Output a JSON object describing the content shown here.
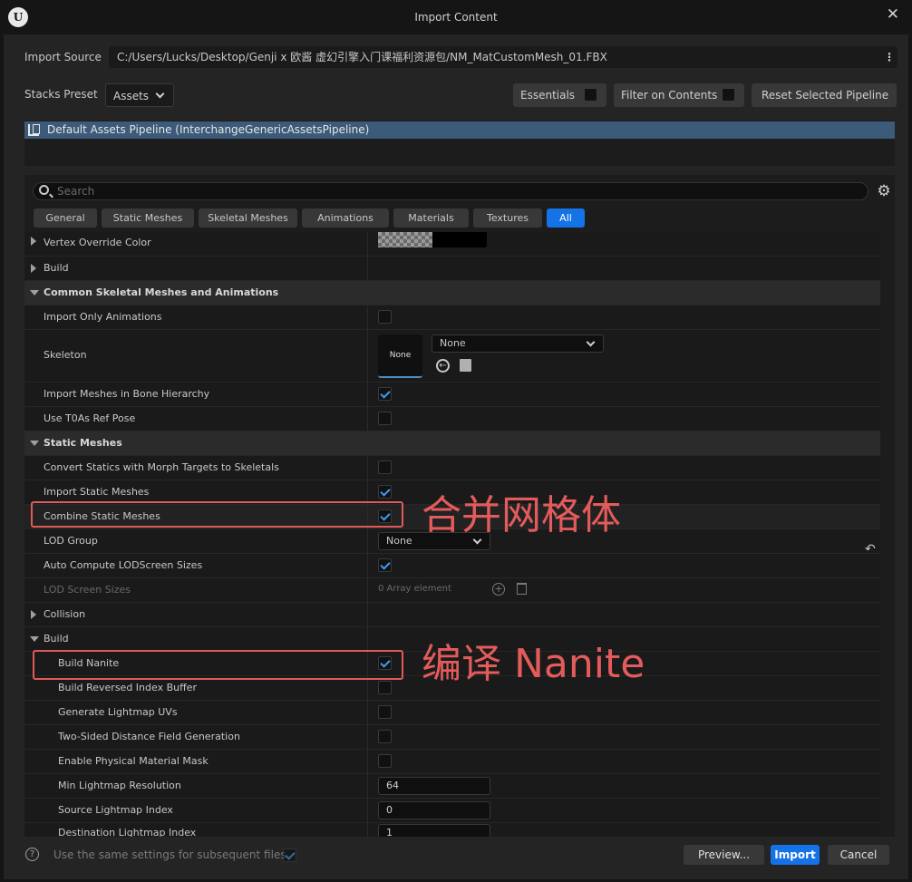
{
  "window": {
    "title": "Import Content"
  },
  "import_source": {
    "label": "Import Source",
    "path": "C:/Users/Lucks/Desktop/Genji x 欧酱 虚幻引擎入门课福利资源包/NM_MatCustomMesh_01.FBX"
  },
  "stacks_preset": {
    "label": "Stacks Preset",
    "value": "Assets",
    "essentials_label": "Essentials",
    "filter_on_contents_label": "Filter on Contents",
    "reset_label": "Reset Selected Pipeline"
  },
  "pipeline": {
    "label": "Default Assets Pipeline (InterchangeGenericAssetsPipeline)"
  },
  "search": {
    "placeholder": "Search"
  },
  "tabs": [
    {
      "label": "General"
    },
    {
      "label": "Static Meshes"
    },
    {
      "label": "Skeletal Meshes"
    },
    {
      "label": "Animations"
    },
    {
      "label": "Materials"
    },
    {
      "label": "Textures"
    },
    {
      "label": "All"
    }
  ],
  "rows": {
    "vertex_override_color": "Vertex Override Color",
    "build_top": "Build",
    "cat_common_skeletal": "Common Skeletal Meshes and Animations",
    "import_only_animations": "Import Only Animations",
    "skeleton": "Skeleton",
    "skeleton_thumb": "None",
    "skeleton_value": "None",
    "import_meshes_bone_hierarchy": "Import Meshes in Bone Hierarchy",
    "use_t0as_ref_pose": "Use T0As Ref Pose",
    "cat_static_meshes": "Static Meshes",
    "convert_statics_morph": "Convert Statics with Morph Targets to Skeletals",
    "import_static_meshes": "Import Static Meshes",
    "combine_static_meshes": "Combine Static Meshes",
    "lod_group": "LOD Group",
    "lod_group_value": "None",
    "auto_compute_lod": "Auto Compute LODScreen Sizes",
    "lod_screen_sizes": "LOD Screen Sizes",
    "lod_screen_sizes_value": "0 Array element",
    "collision": "Collision",
    "build": "Build",
    "build_nanite": "Build Nanite",
    "build_reversed_index": "Build Reversed Index Buffer",
    "generate_lightmap_uvs": "Generate Lightmap UVs",
    "two_sided_distance": "Two-Sided Distance Field Generation",
    "enable_physical_material_mask": "Enable Physical Material Mask",
    "min_lightmap_resolution": "Min Lightmap Resolution",
    "min_lightmap_resolution_value": "64",
    "source_lightmap_index": "Source Lightmap Index",
    "source_lightmap_index_value": "0",
    "destination_lightmap_index": "Destination Lightmap Index",
    "destination_lightmap_index_value": "1"
  },
  "annotations": {
    "combine": "合并网格体",
    "nanite": "编译 Nanite"
  },
  "footer": {
    "same_settings_label": "Use the same settings for subsequent files",
    "preview_label": "Preview...",
    "import_label": "Import",
    "cancel_label": "Cancel"
  },
  "colors": {
    "accent": "#1473e6",
    "selection": "#3c5a7a",
    "annotation": "#e05a5a",
    "check": "#3f9bf4"
  }
}
